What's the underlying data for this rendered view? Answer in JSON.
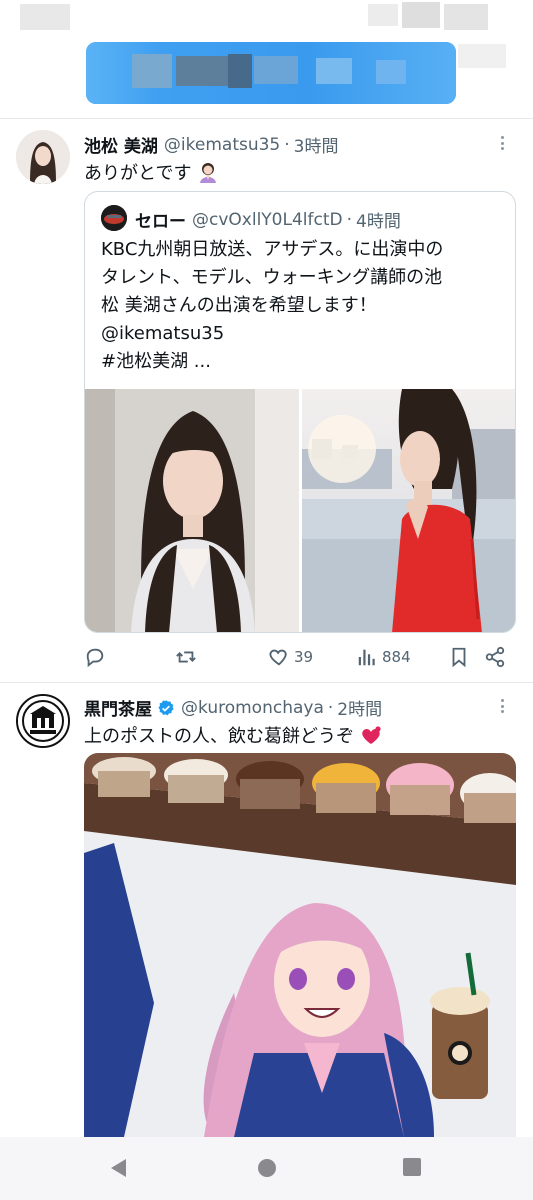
{
  "tweets": [
    {
      "author_name": "池松 美湖",
      "handle": "@ikematsu35",
      "time": "3時間",
      "text": "ありがとです",
      "quote": {
        "author_name": "セロー",
        "handle": "@cvOxllY0L4lfctD",
        "time": "4時間",
        "text_lines": [
          "KBC九州朝日放送、アサデス。に出演中の",
          "タレント、モデル、ウォーキング講師の池",
          "松 美湖さんの出演を希望します！",
          "@ikematsu35",
          " #池松美湖 ..."
        ]
      },
      "actions": {
        "reply_count": "",
        "retweet_count": "",
        "like_count": "39",
        "view_count": "884"
      }
    },
    {
      "author_name": "黒門茶屋",
      "verified": true,
      "handle": "@kuromonchaya",
      "time": "2時間",
      "text": "上のポストの人、飲む葛餅どうぞ"
    }
  ],
  "icons": {
    "more": "more-vertical-icon",
    "reply": "reply-icon",
    "retweet": "retweet-icon",
    "like": "heart-icon",
    "views": "views-icon",
    "bookmark": "bookmark-icon",
    "share": "share-icon",
    "nav_back": "back-triangle-icon",
    "nav_home": "home-circle-icon",
    "nav_recents": "recents-square-icon"
  },
  "colors": {
    "accent": "#1d9bf0",
    "secondary_text": "#536471",
    "heart_emoji": "#e0245e"
  }
}
